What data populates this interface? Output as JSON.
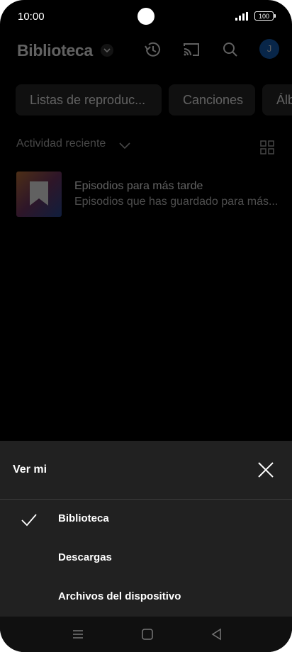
{
  "status": {
    "time": "10:00",
    "battery": "100"
  },
  "header": {
    "title": "Biblioteca",
    "avatar_initial": "J"
  },
  "chips": [
    {
      "label": "Listas de reproduc..."
    },
    {
      "label": "Canciones"
    },
    {
      "label": "Álb"
    }
  ],
  "recent": {
    "label": "Actividad reciente"
  },
  "items": [
    {
      "title": "Episodios para más tarde",
      "subtitle": "Episodios que has guardado para más..."
    }
  ],
  "sheet": {
    "title": "Ver mi",
    "options": [
      {
        "label": "Biblioteca",
        "selected": true
      },
      {
        "label": "Descargas",
        "selected": false
      },
      {
        "label": "Archivos del dispositivo",
        "selected": false
      }
    ]
  },
  "colors": {
    "avatar": "#1565c0",
    "sheet_bg": "#212121",
    "chip_bg": "#2b2b2b"
  }
}
